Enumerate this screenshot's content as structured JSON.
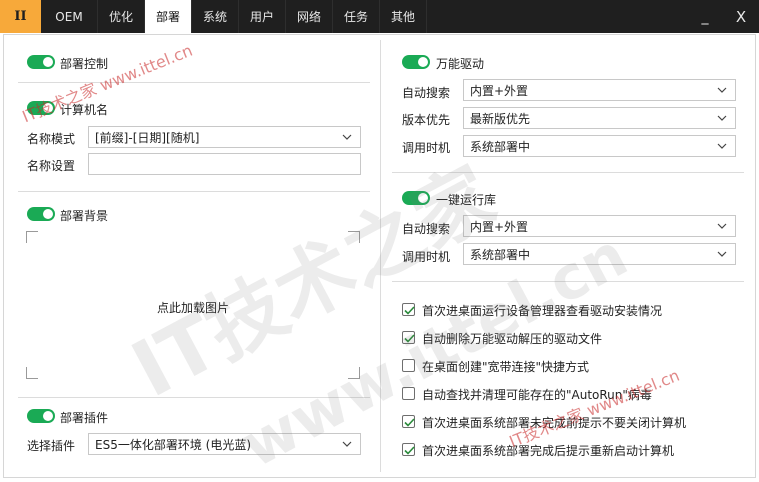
{
  "tabs": {
    "app": "II",
    "items": [
      "OEM",
      "优化",
      "部署",
      "系统",
      "用户",
      "网络",
      "任务",
      "其他"
    ],
    "active": "部署"
  },
  "window": {
    "minimize": "_",
    "close": "X"
  },
  "left": {
    "deploy_control": {
      "label": "部署控制",
      "on": true
    },
    "computer_name": {
      "label": "计算机名",
      "on": true,
      "mode_label": "名称模式",
      "mode_value": "[前缀]-[日期][随机]",
      "setting_label": "名称设置",
      "setting_value": ""
    },
    "background": {
      "label": "部署背景",
      "on": true,
      "hint": "点此加载图片"
    },
    "plugin": {
      "label": "部署插件",
      "on": true,
      "select_label": "选择插件",
      "select_value": "ES5一体化部署环境 (电光蓝)"
    }
  },
  "right": {
    "driver": {
      "label": "万能驱动",
      "on": true,
      "search_label": "自动搜索",
      "search_value": "内置+外置",
      "version_label": "版本优先",
      "version_value": "最新版优先",
      "timing_label": "调用时机",
      "timing_value": "系统部署中"
    },
    "runtime": {
      "label": "一键运行库",
      "on": true,
      "search_label": "自动搜索",
      "search_value": "内置+外置",
      "timing_label": "调用时机",
      "timing_value": "系统部署中"
    },
    "options": [
      {
        "label": "首次进桌面运行设备管理器查看驱动安装情况",
        "checked": true
      },
      {
        "label": "自动删除万能驱动解压的驱动文件",
        "checked": true
      },
      {
        "label": "在桌面创建\"宽带连接\"快捷方式",
        "checked": false
      },
      {
        "label": "自动查找并清理可能存在的\"AutoRun\"病毒",
        "checked": false
      },
      {
        "label": "首次进桌面系统部署未完成前提示不要关闭计算机",
        "checked": true
      },
      {
        "label": "首次进桌面系统部署完成后提示重新启动计算机",
        "checked": true
      }
    ]
  },
  "watermark": {
    "small1": "IT技术之家 www.ittel.cn",
    "small2": "IT技术之家 www.ittel.cn",
    "big": "IT技术之家",
    "big2": "www.ittel.cn"
  },
  "colors": {
    "accent": "#f7a93a",
    "toggle": "#1aaa55",
    "tabbar": "#1f1f1f"
  }
}
